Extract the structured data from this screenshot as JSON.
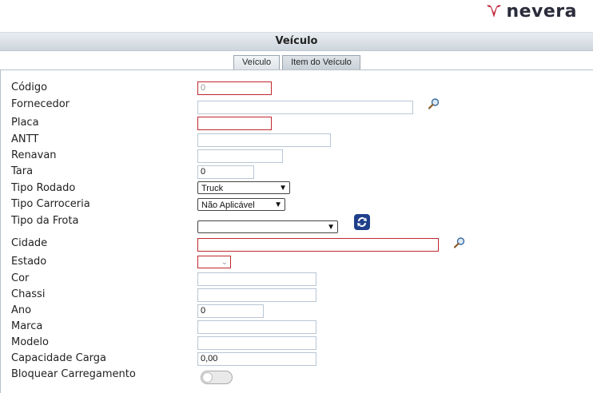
{
  "header": {
    "logo_text": "nevera"
  },
  "page": {
    "title": "Veículo"
  },
  "tabs": [
    {
      "label": "Veículo"
    },
    {
      "label": "Item do Veículo"
    }
  ],
  "form": {
    "codigo": {
      "label": "Código",
      "placeholder": "0"
    },
    "fornecedor": {
      "label": "Fornecedor",
      "value": ""
    },
    "placa": {
      "label": "Placa",
      "value": ""
    },
    "antt": {
      "label": "ANTT",
      "value": ""
    },
    "renavan": {
      "label": "Renavan",
      "value": ""
    },
    "tara": {
      "label": "Tara",
      "value": "0"
    },
    "tipo_rodado": {
      "label": "Tipo Rodado",
      "value": "Truck"
    },
    "tipo_carroceria": {
      "label": "Tipo Carroceria",
      "value": "Não Aplicável"
    },
    "tipo_frota": {
      "label": "Tipo da Frota",
      "value": ""
    },
    "cidade": {
      "label": "Cidade",
      "value": ""
    },
    "estado": {
      "label": "Estado",
      "value": ""
    },
    "cor": {
      "label": "Cor",
      "value": ""
    },
    "chassi": {
      "label": "Chassi",
      "value": ""
    },
    "ano": {
      "label": "Ano",
      "value": "0"
    },
    "marca": {
      "label": "Marca",
      "value": ""
    },
    "modelo": {
      "label": "Modelo",
      "value": ""
    },
    "capacidade_carga": {
      "label": "Capacidade Carga",
      "value": "0,00"
    },
    "bloquear_carregamento": {
      "label": "Bloquear Carregamento",
      "checked": false
    }
  },
  "icons": {
    "search": "magnifier-icon",
    "refresh": "refresh-icon",
    "logo": "nevera-logo-icon"
  },
  "colors": {
    "required_border": "#c0282d",
    "refresh_button": "#1f3f8a",
    "logo_mark": "#c0283c"
  }
}
